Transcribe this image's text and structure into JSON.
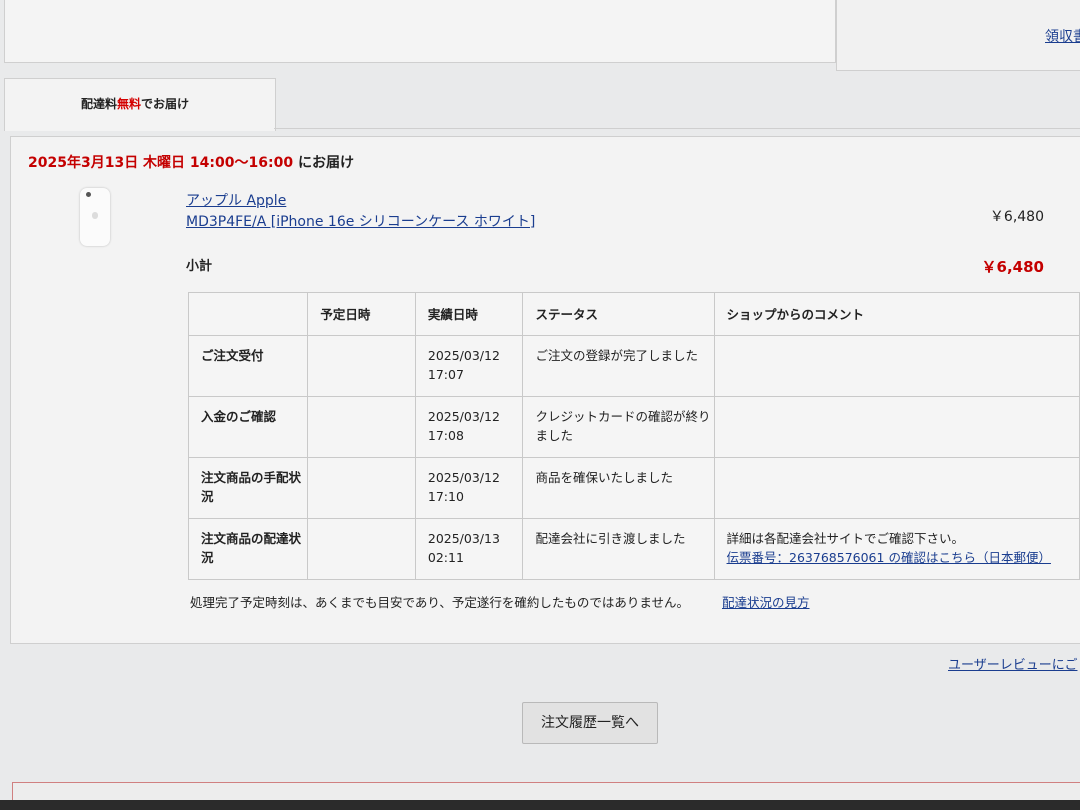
{
  "header": {
    "receipt_link": "領収書"
  },
  "tab": {
    "label_prefix": "配達料",
    "label_highlight": "無料",
    "label_suffix": "でお届け"
  },
  "delivery": {
    "date_text": "2025年3月13日 木曜日 14:00～16:00",
    "suffix": " にお届け"
  },
  "product": {
    "maker": "アップル Apple",
    "name": "MD3P4FE/A [iPhone 16e シリコーンケース ホワイト]",
    "price": "￥6,480"
  },
  "subtotal": {
    "label": "小計",
    "value": "￥6,480"
  },
  "status_table": {
    "headers": [
      "",
      "予定日時",
      "実績日時",
      "ステータス",
      "ショップからのコメント"
    ],
    "rows": [
      {
        "label": "ご注文受付",
        "planned": "",
        "actual_date": "2025/03/12",
        "actual_time": "17:07",
        "status": "ご注文の登録が完了しました",
        "comment": "",
        "comment_link": ""
      },
      {
        "label": "入金のご確認",
        "planned": "",
        "actual_date": "2025/03/12",
        "actual_time": "17:08",
        "status": "クレジットカードの確認が終りました",
        "comment": "",
        "comment_link": ""
      },
      {
        "label": "注文商品の手配状況",
        "planned": "",
        "actual_date": "2025/03/12",
        "actual_time": "17:10",
        "status": "商品を確保いたしました",
        "comment": "",
        "comment_link": ""
      },
      {
        "label": "注文商品の配達状況",
        "planned": "",
        "actual_date": "2025/03/13",
        "actual_time": "02:11",
        "status": "配達会社に引き渡しました",
        "comment": "詳細は各配達会社サイトでご確認下さい。",
        "comment_link": "伝票番号：263768576061 の確認はこちら（日本郵便）"
      }
    ]
  },
  "note": {
    "text": "処理完了予定時刻は、あくまでも目安であり、予定遂行を確約したものではありません。",
    "link": "配達状況の見方"
  },
  "review_link": "ユーザーレビューにご",
  "history_button": "注文履歴一覧へ"
}
